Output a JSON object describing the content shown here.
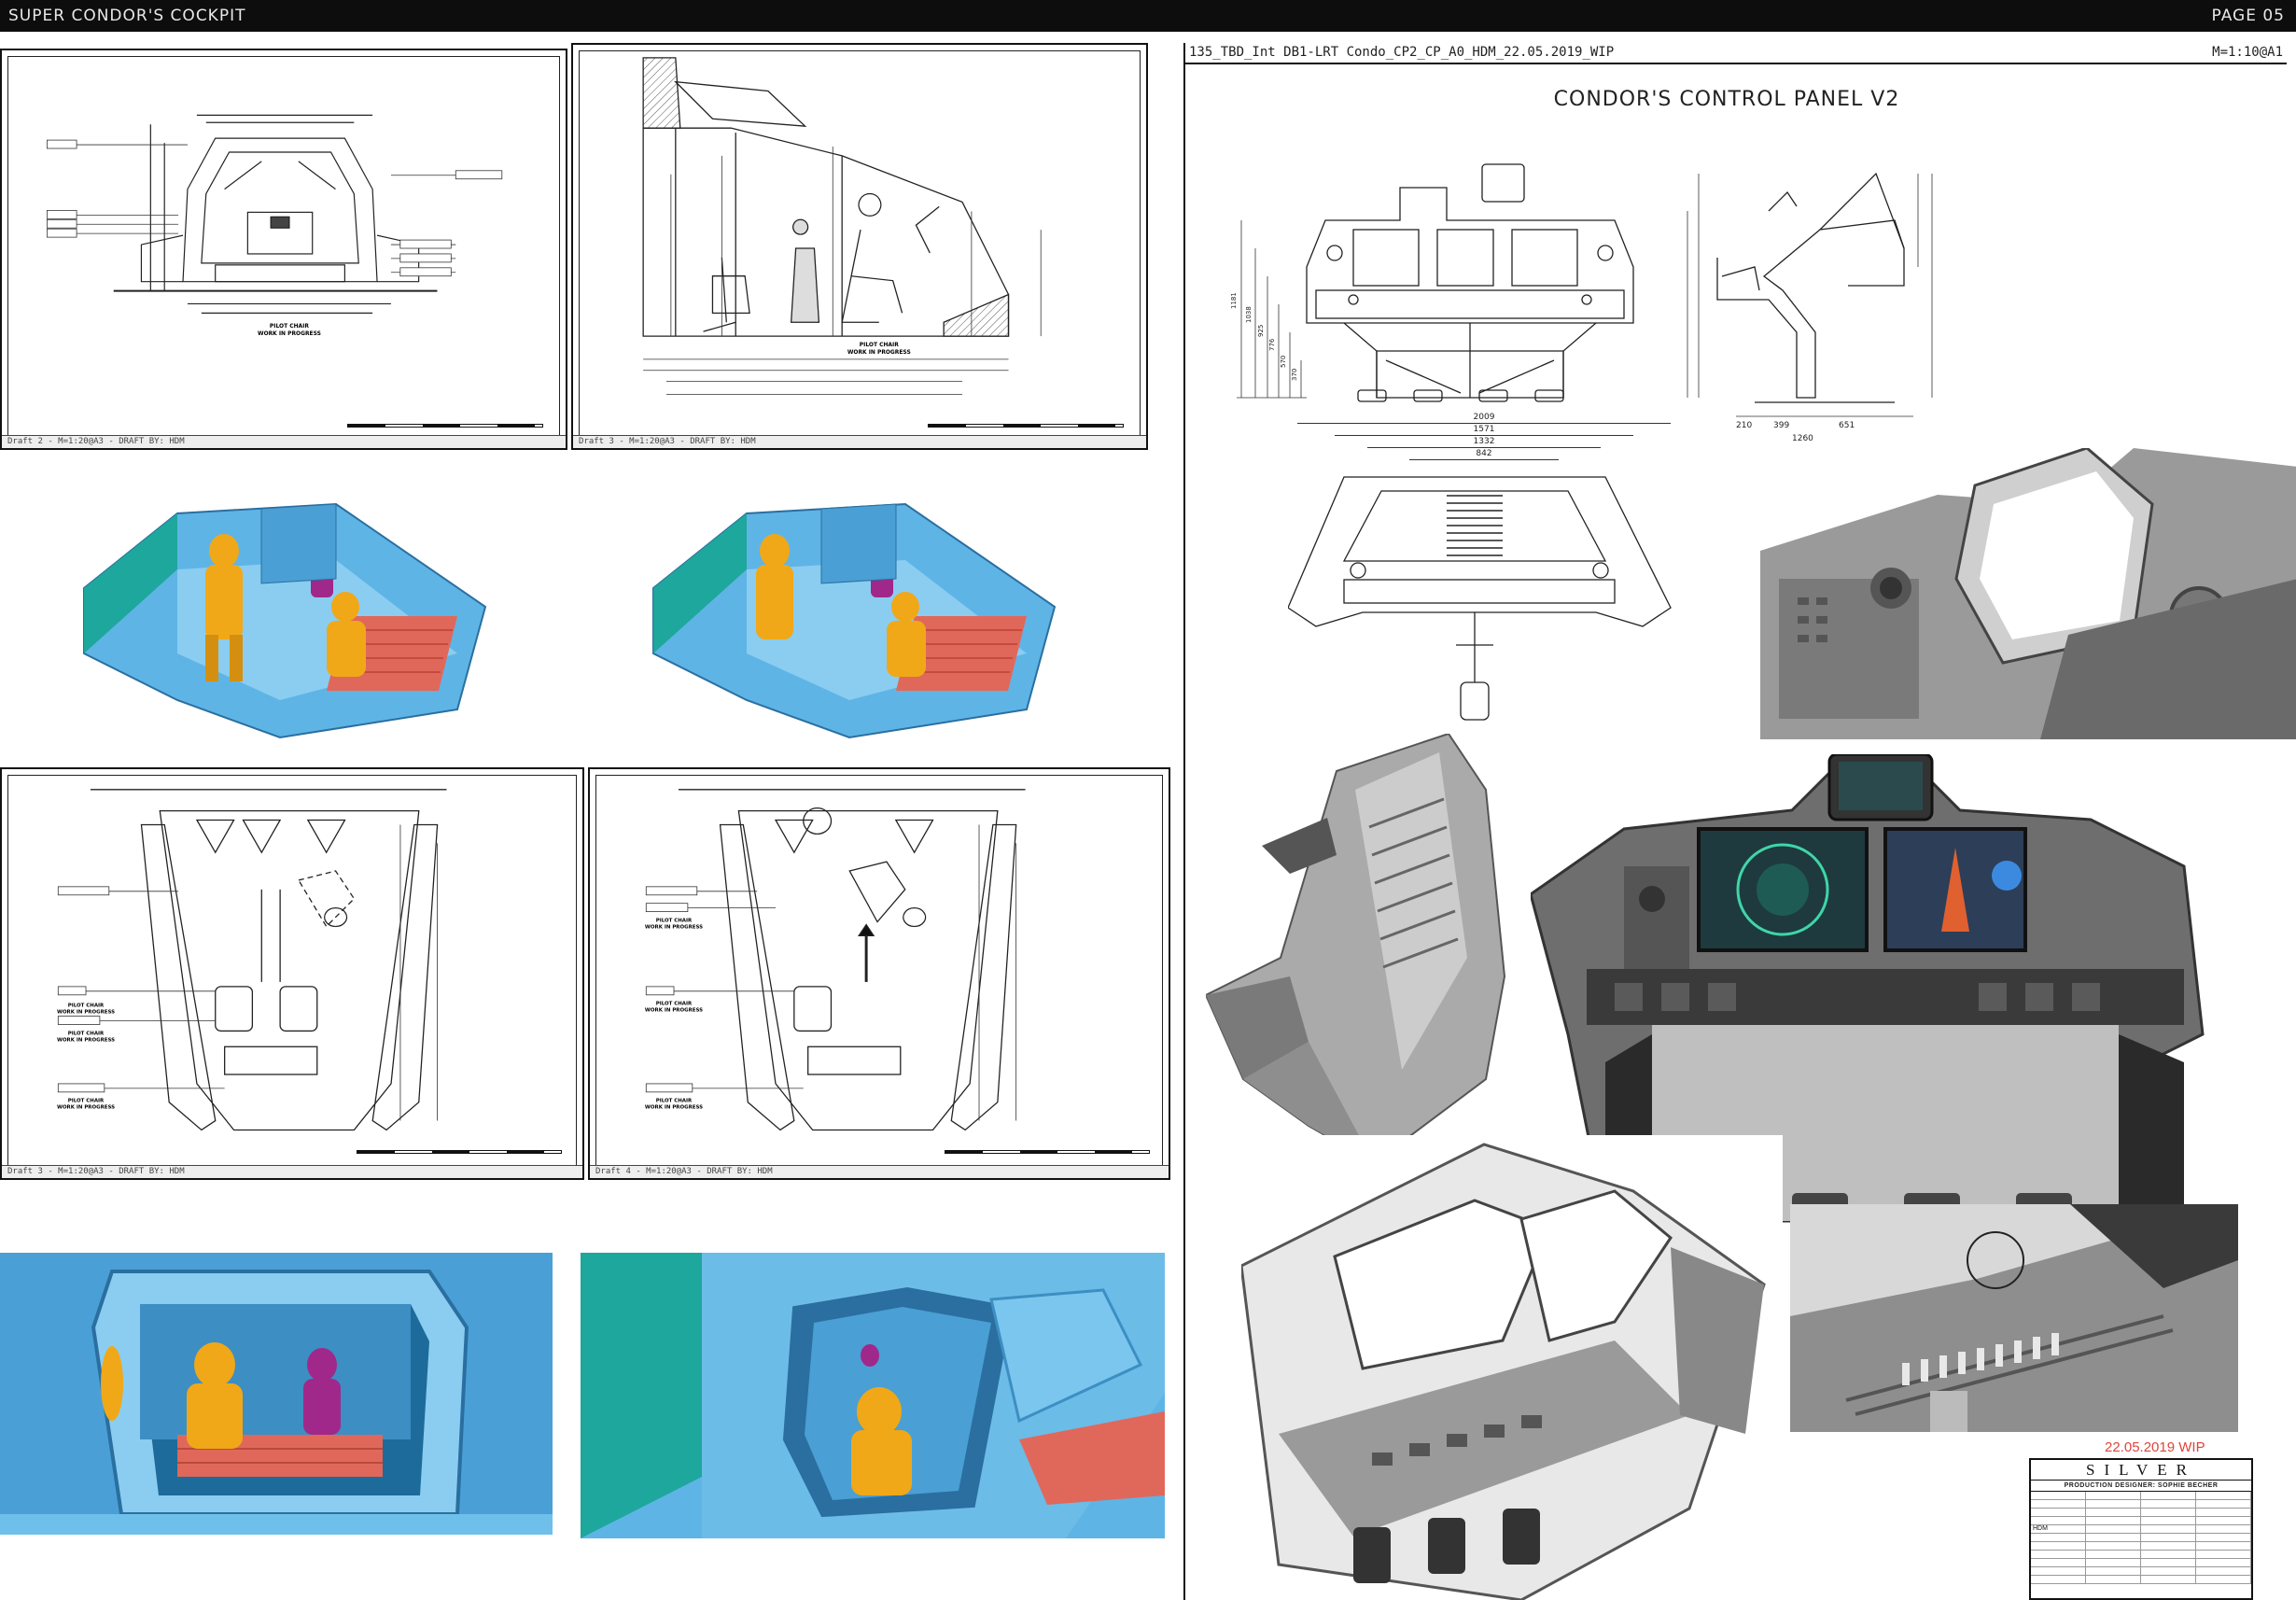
{
  "header": {
    "title": "SUPER CONDOR'S COCKPIT",
    "page": "PAGE 05"
  },
  "drawings": {
    "front_view": {
      "footer": "Draft 2 - M=1:20@A3 - DRAFT BY: HDM",
      "caption": "PILOT CHAIR\nWORK IN PROGRESS"
    },
    "side_view": {
      "footer": "Draft 3 - M=1:20@A3 - DRAFT BY: HDM",
      "caption": "PILOT CHAIR\nWORK IN PROGRESS"
    },
    "plan_a": {
      "footer": "Draft 3 - M=1:20@A3 - DRAFT BY: HDM",
      "caption": "PILOT CHAIR\nWORK IN PROGRESS"
    },
    "plan_b": {
      "footer": "Draft 4 - M=1:20@A3 - DRAFT BY: HDM",
      "caption": "PILOT CHAIR\nWORK IN PROGRESS"
    }
  },
  "sheet": {
    "file_label": "135_TBD_Int DB1-LRT Condo_CP2_CP_A0_HDM_22.05.2019_WIP",
    "scale": "M=1:10@A1",
    "title": "CONDOR'S CONTROL PANEL V2",
    "dims_front_bottom": [
      "2009",
      "1571",
      "1332",
      "842"
    ],
    "dims_side_bottom": [
      "210",
      "399",
      "651",
      "1260"
    ],
    "dims_left": [
      "1181",
      "1038",
      "925",
      "776",
      "570",
      "370"
    ]
  },
  "titleblock": {
    "wip": "22.05.2019 WIP",
    "brand": "SILVER",
    "designer": "PRODUCTION DESIGNER: SOPHIE BECHER",
    "drawn_by": "HDM"
  },
  "colors": {
    "blueprint_blue": "#5fb4e6",
    "teal": "#1ea79c",
    "figure_gold": "#f0a818",
    "figure_purple": "#a0288a",
    "seat_red": "#e0685a",
    "render_grey": "#8a8a8a"
  }
}
